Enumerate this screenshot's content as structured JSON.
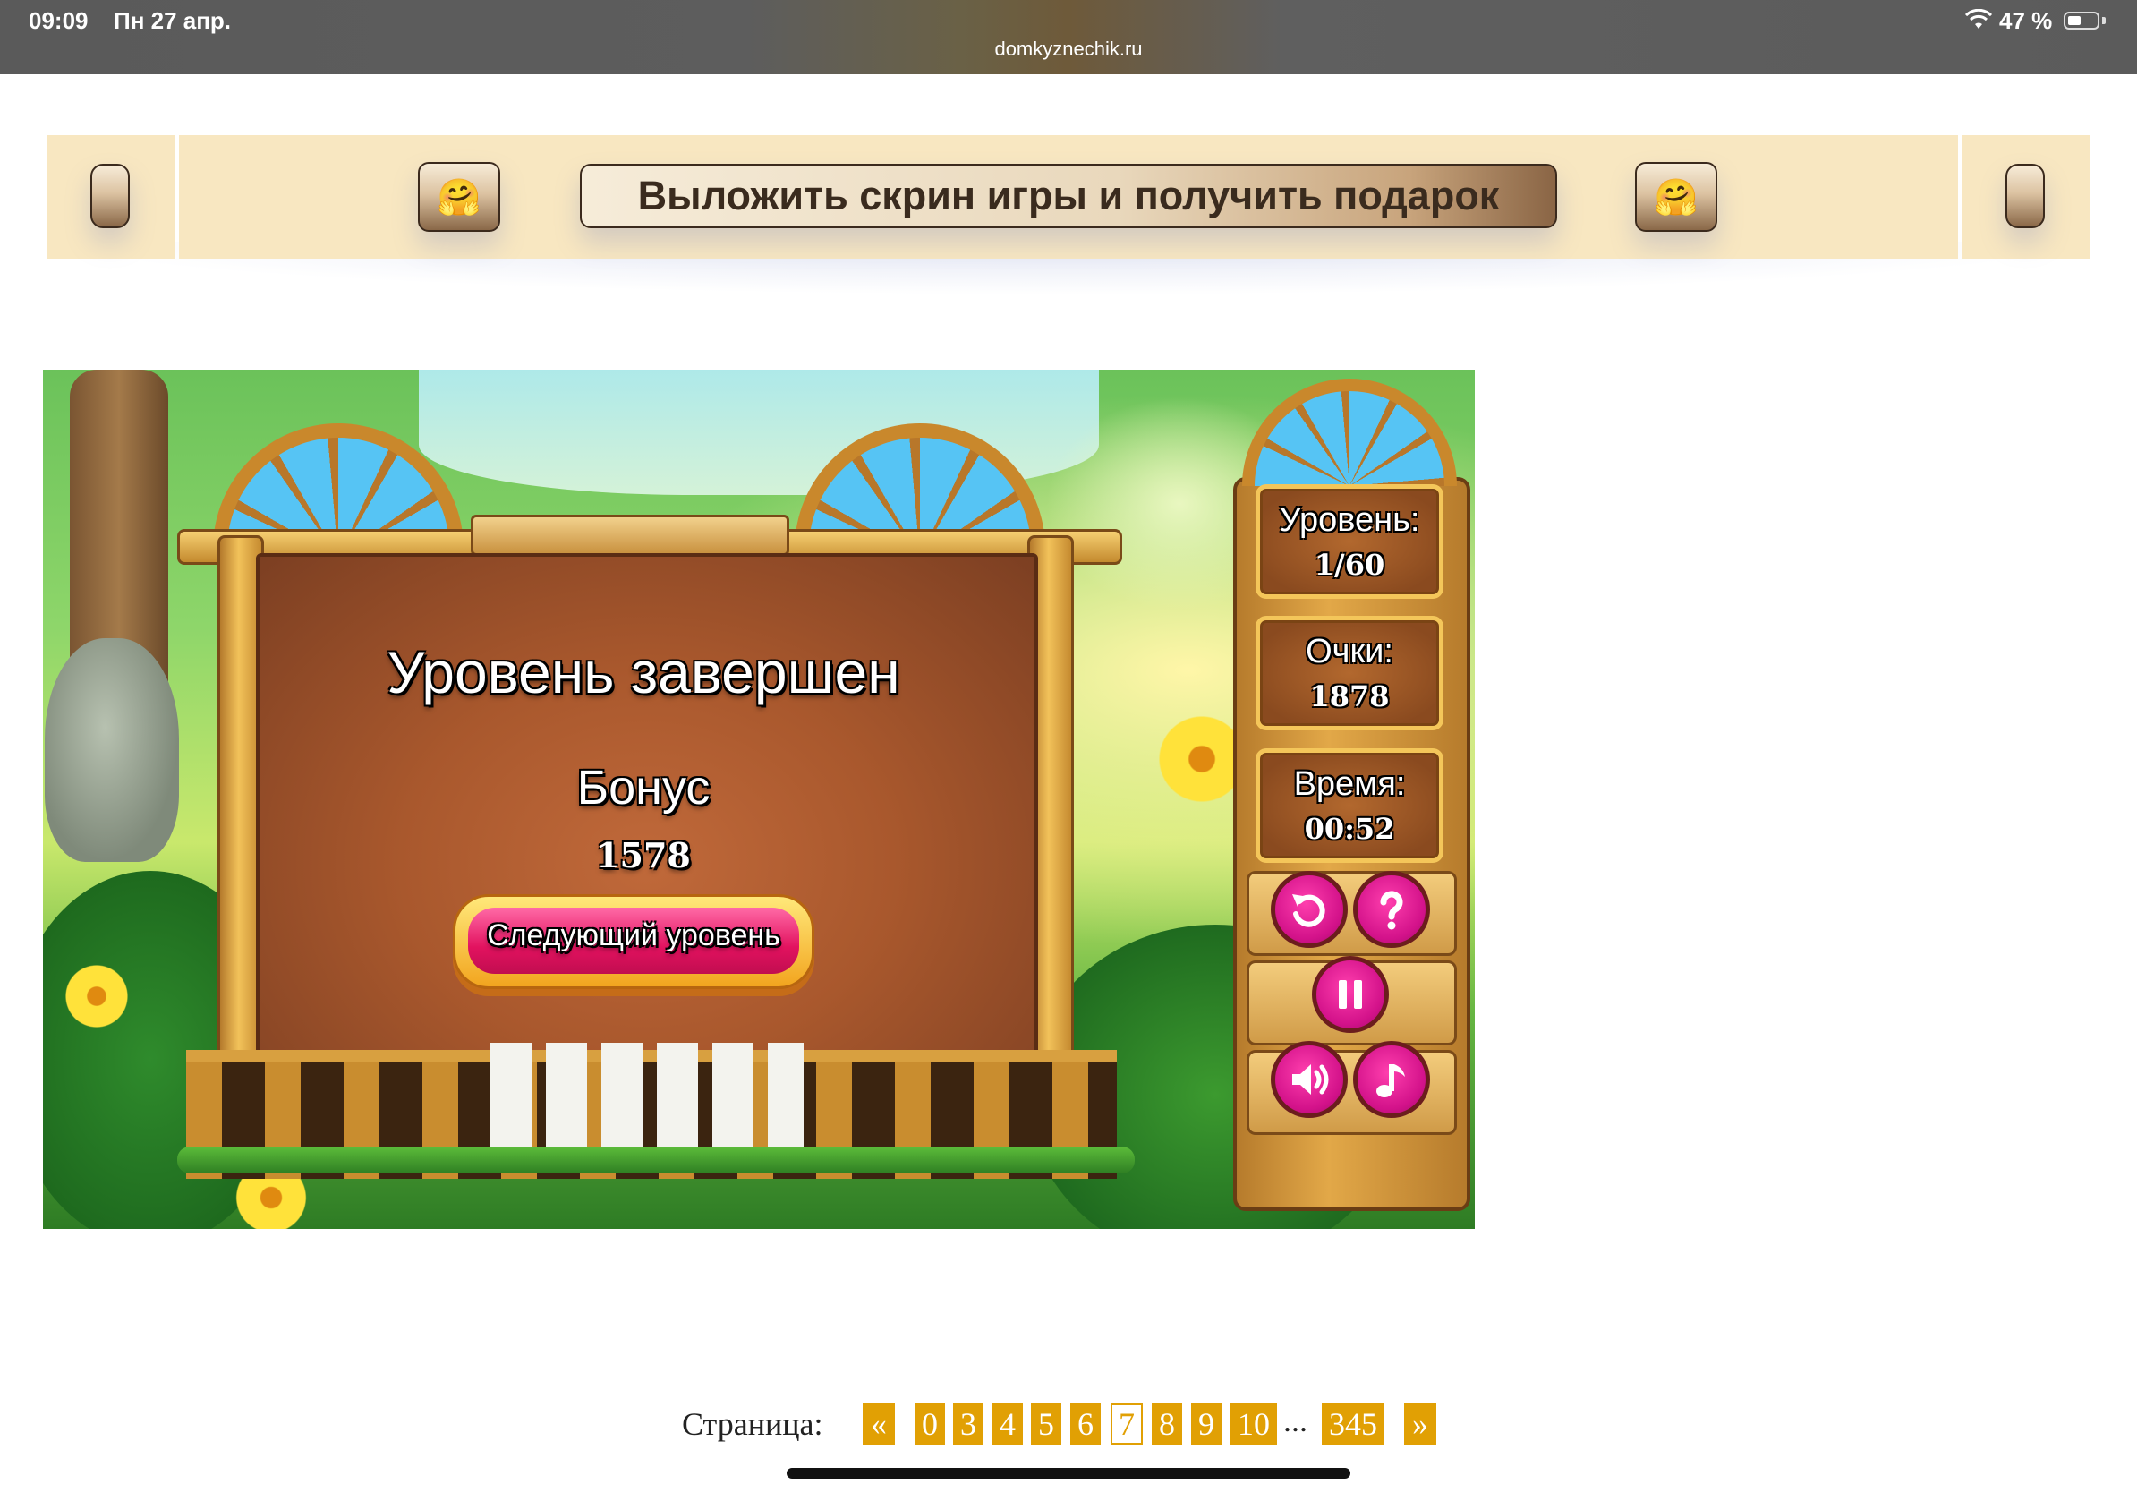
{
  "status_bar": {
    "time": "09:09",
    "date": "Пн 27 апр.",
    "url": "domkyznechik.ru",
    "battery_percent": "47 %",
    "battery_level": 0.47
  },
  "banner": {
    "main_label": "Выложить скрин игры и получить подарок",
    "emoji_left": "🤗",
    "emoji_right": "🤗"
  },
  "game": {
    "title": "Уровень завершен",
    "bonus_label": "Бонус",
    "bonus_value": "1578",
    "next_button": "Следующий уровень",
    "stats": {
      "level_label": "Уровень:",
      "level_value": "1/60",
      "score_label": "Очки:",
      "score_value": "1878",
      "time_label": "Время:",
      "time_value": "00:52"
    },
    "controls": [
      "restart-icon",
      "help-icon",
      "pause-icon",
      "sound-icon",
      "music-icon"
    ],
    "colors": {
      "button_pink": "#e2125f",
      "wood": "#c9882c"
    }
  },
  "pagination": {
    "label": "Страница:",
    "prev": "«",
    "next": "»",
    "pages": [
      "0",
      "3",
      "4",
      "5",
      "6",
      "7",
      "8",
      "9",
      "10",
      "345"
    ],
    "current": "7",
    "ellipsis": "...",
    "accent": "#e1a004"
  }
}
